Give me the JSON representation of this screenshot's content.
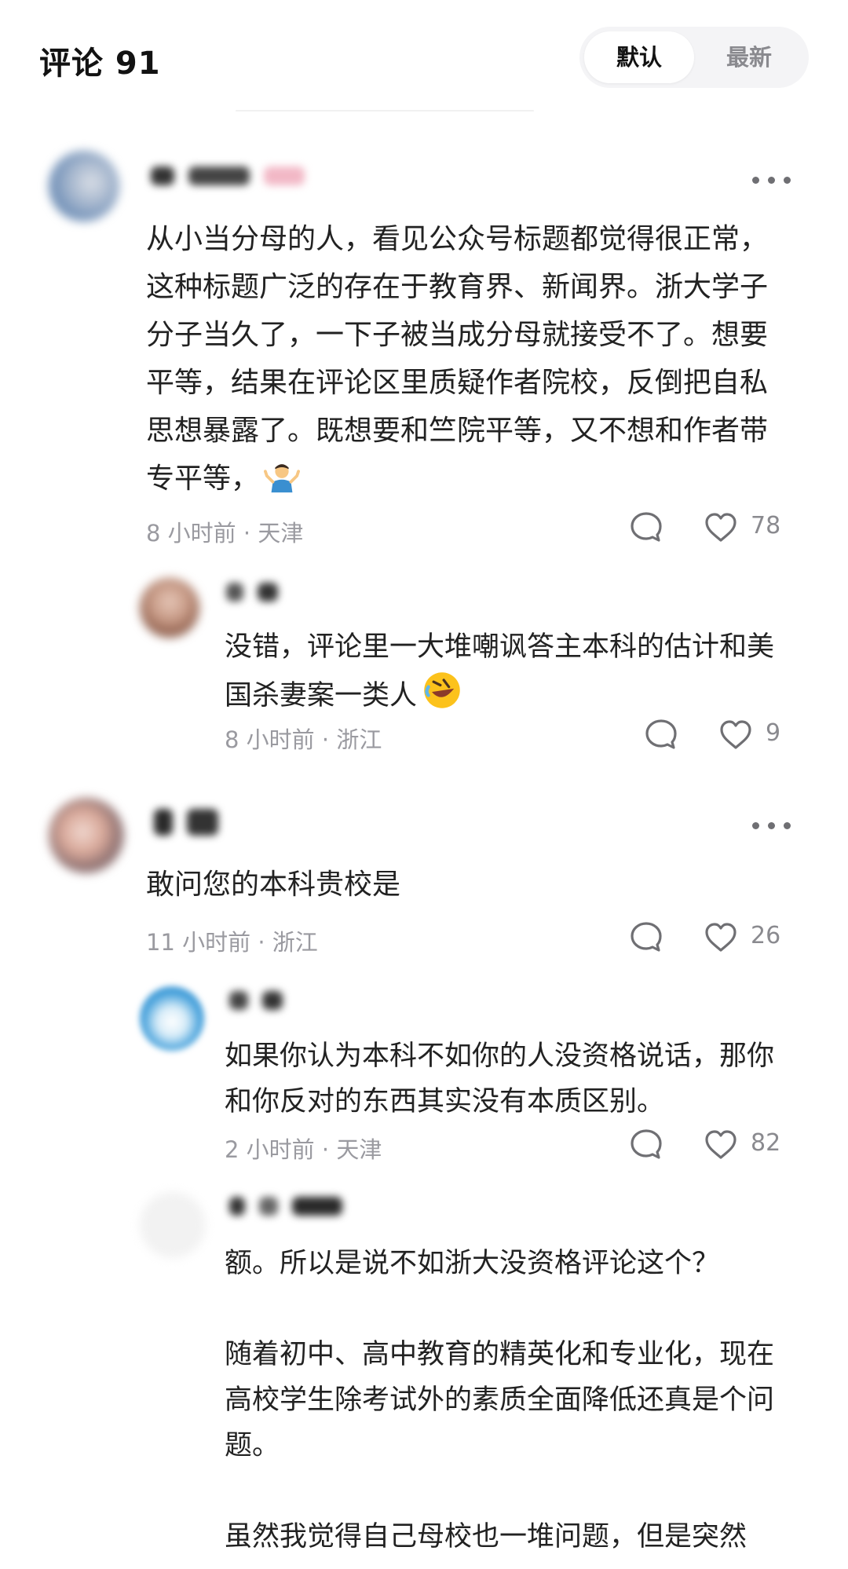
{
  "header": {
    "title": "评论 91",
    "sort_options": [
      "默认",
      "最新"
    ]
  },
  "comments": [
    {
      "text": "从小当分母的人，看见公众号标题都觉得很正常，这种标题广泛的存在于教育界、新闻界。浙大学子分子当久了，一下子被当成分母就接受不了。想要平等，结果在评论区里质疑作者院校，反倒把自私思想暴露了。既想要和竺院平等，又不想和作者带专平等，",
      "emoji": "man-shrugging",
      "meta": "8 小时前 · 天津",
      "likes": "78",
      "replies": [
        {
          "text": "没错，评论里一大堆嘲讽答主本科的估计和美国杀妻案一类人",
          "emoji": "rolling-on-floor-laughing",
          "meta": "8 小时前 · 浙江",
          "likes": "9"
        }
      ]
    },
    {
      "text": "敢问您的本科贵校是",
      "meta": "11 小时前 · 浙江",
      "likes": "26",
      "replies": [
        {
          "text": "如果你认为本科不如你的人没资格说话，那你和你反对的东西其实没有本质区别。",
          "meta": "2 小时前 · 天津",
          "likes": "82"
        },
        {
          "text": "额。所以是说不如浙大没资格评论这个？\n\n随着初中、高中教育的精英化和专业化，现在高校学生除考试外的素质全面降低还真是个问题。\n\n虽然我觉得自己母校也一堆问题，但是突然"
        }
      ]
    }
  ],
  "colors": {
    "text": "#222222",
    "meta": "#9a9aa0",
    "icon": "#6f6f73",
    "toggle_bg": "#f4f4f6"
  }
}
